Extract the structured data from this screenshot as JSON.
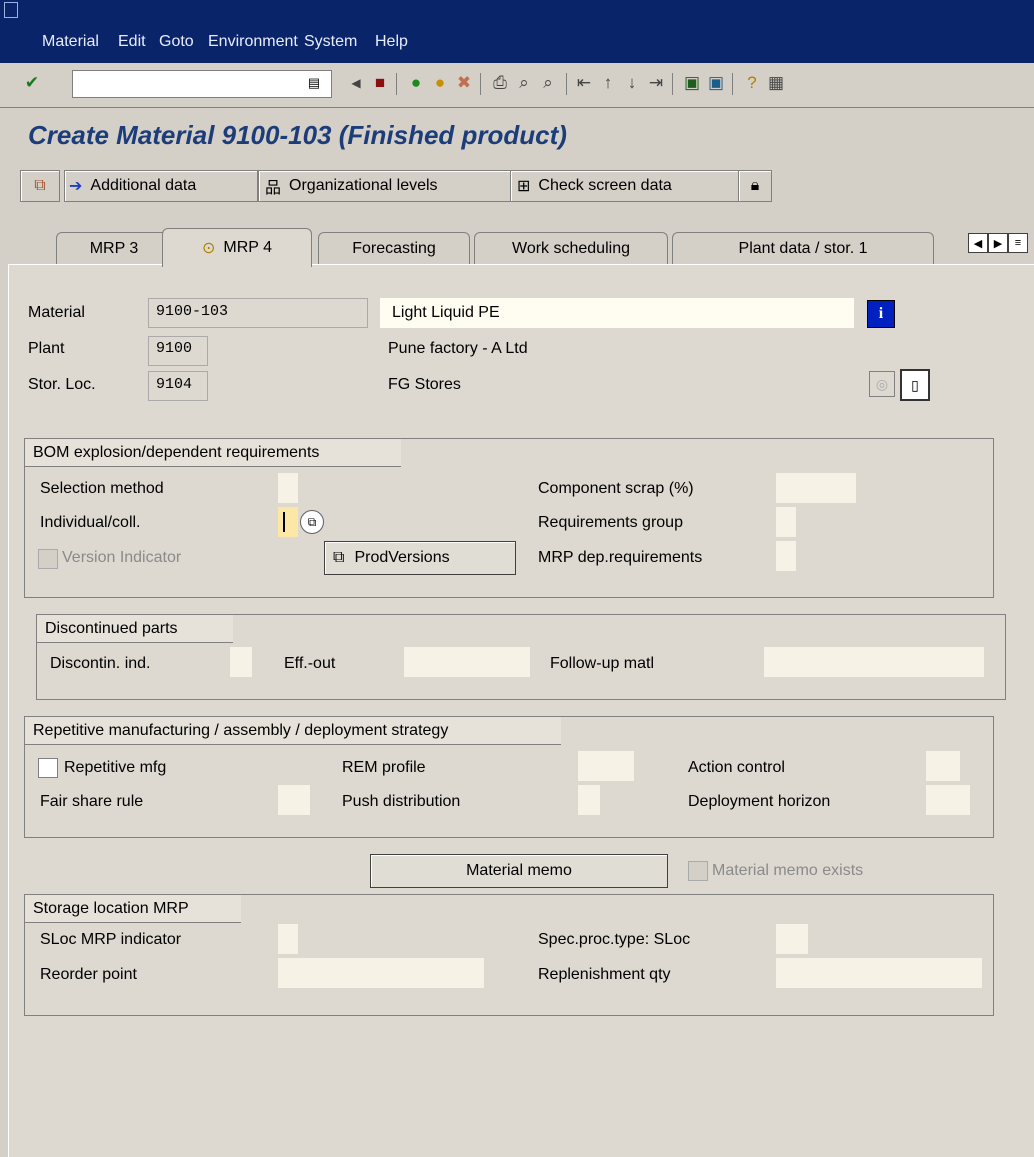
{
  "menu": [
    "Material",
    "Edit",
    "Goto",
    "Environment",
    "System",
    "Help"
  ],
  "title": "Create Material 9100-103 (Finished product)",
  "app_toolbar": {
    "additional_data": "Additional data",
    "org_levels": "Organizational levels",
    "check_screen": "Check screen data"
  },
  "tabs": [
    "MRP 3",
    "MRP 4",
    "Forecasting",
    "Work scheduling",
    "Plant data / stor. 1"
  ],
  "header": {
    "material_label": "Material",
    "material_value": "9100-103",
    "material_desc": "Light Liquid PE",
    "plant_label": "Plant",
    "plant_value": "9100",
    "plant_desc": "Pune factory - A Ltd",
    "sloc_label": "Stor. Loc.",
    "sloc_value": "9104",
    "sloc_desc": "FG Stores"
  },
  "bom": {
    "title": "BOM explosion/dependent requirements",
    "selection_method": "Selection method",
    "individual_coll": "Individual/coll.",
    "version_indicator": "Version Indicator",
    "prodversions": "ProdVersions",
    "component_scrap": "Component scrap (%)",
    "requirements_group": "Requirements group",
    "mrp_dep": "MRP dep.requirements"
  },
  "discontinued": {
    "title": "Discontinued parts",
    "discontin_ind": "Discontin. ind.",
    "eff_out": "Eff.-out",
    "follow_up": "Follow-up matl"
  },
  "repetitive": {
    "title": "Repetitive manufacturing / assembly / deployment strategy",
    "repetitive_mfg": "Repetitive mfg",
    "rem_profile": "REM profile",
    "action_control": "Action control",
    "fair_share": "Fair share rule",
    "push_distribution": "Push distribution",
    "deployment_horizon": "Deployment horizon"
  },
  "memo": {
    "button": "Material memo",
    "exists": "Material memo exists"
  },
  "sloc_mrp": {
    "title": "Storage location MRP",
    "sloc_mrp_indicator": "SLoc MRP indicator",
    "spec_proc": "Spec.proc.type: SLoc",
    "reorder_point": "Reorder point",
    "replenishment_qty": "Replenishment qty"
  },
  "colors": {
    "menubar": "#0a246a",
    "title": "#1c3d7a",
    "background": "#d4d0c8",
    "input": "#f6f3e6"
  }
}
